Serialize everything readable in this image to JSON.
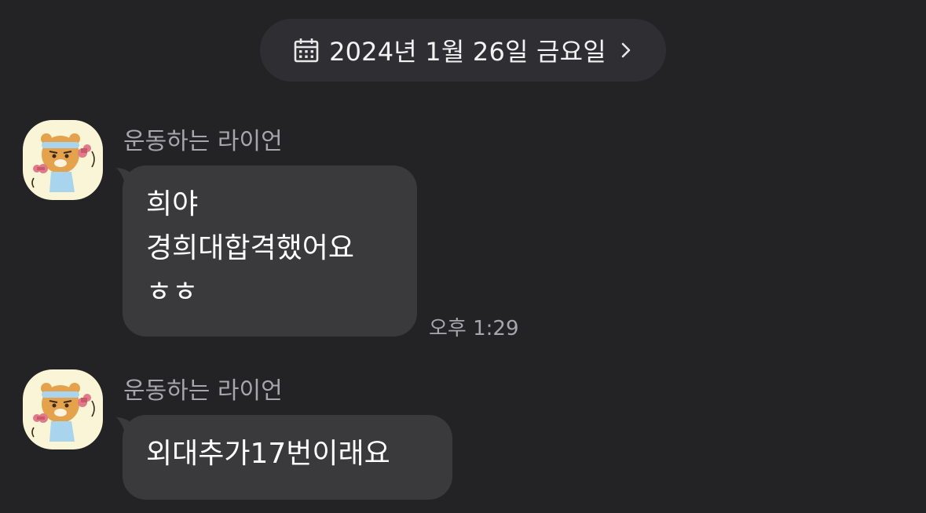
{
  "date_header": {
    "label": "2024년 1월 26일 금요일",
    "icon": "calendar-icon",
    "chevron": "chevron-right-icon"
  },
  "messages": [
    {
      "sender": "운동하는 라이언",
      "lines": [
        "희야",
        "경희대합격했어요",
        "ㅎㅎ"
      ],
      "time": "오후 1:29",
      "avatar": "ryan-exercise-avatar"
    },
    {
      "sender": "운동하는 라이언",
      "lines": [
        "외대추가17번이래요"
      ],
      "time": "",
      "avatar": "ryan-exercise-avatar"
    }
  ],
  "colors": {
    "background": "#232326",
    "pill": "#2f2f33",
    "bubble": "#3a3a3d",
    "secondary_text": "#a7a7ab",
    "avatar_bg": "#fbf5d7"
  }
}
